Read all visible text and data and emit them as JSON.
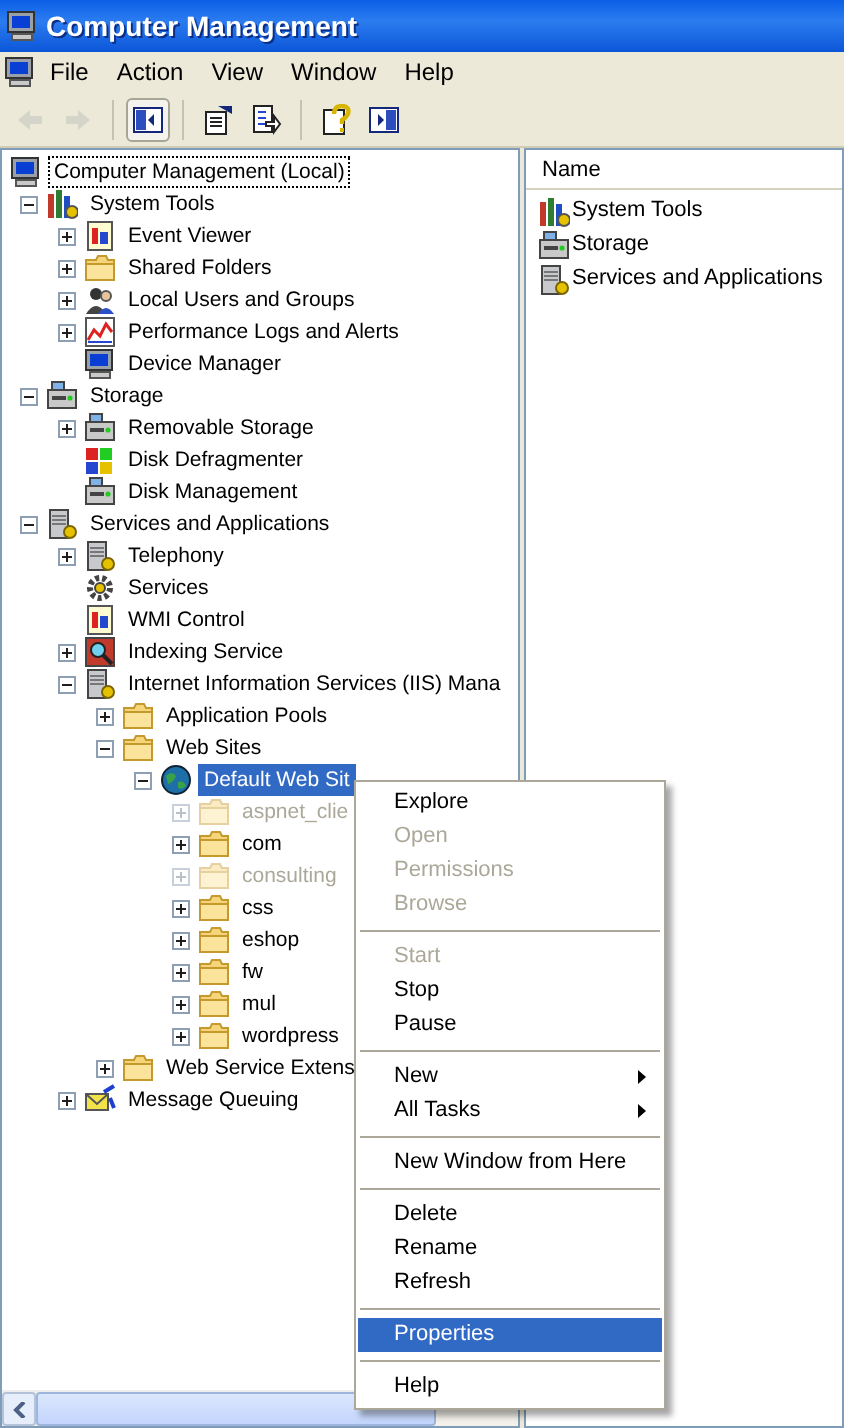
{
  "window": {
    "title": "Computer Management"
  },
  "menu_bar": [
    "File",
    "Action",
    "View",
    "Window",
    "Help"
  ],
  "toolbar": [
    {
      "kind": "back",
      "disabled": true,
      "pressed": false
    },
    {
      "kind": "forward",
      "disabled": true,
      "pressed": false
    },
    {
      "kind": "separator"
    },
    {
      "kind": "tree",
      "disabled": false,
      "pressed": true
    },
    {
      "kind": "separator"
    },
    {
      "kind": "properties",
      "disabled": false,
      "pressed": false
    },
    {
      "kind": "export",
      "disabled": false,
      "pressed": false
    },
    {
      "kind": "separator"
    },
    {
      "kind": "help",
      "disabled": false,
      "pressed": false
    },
    {
      "kind": "pane",
      "disabled": false,
      "pressed": false
    }
  ],
  "tree": [
    {
      "label": "Computer Management (Local)",
      "kind": "computer",
      "selected": false,
      "focused": true,
      "dimmed": false,
      "children": [
        {
          "label": "System Tools",
          "kind": "tools",
          "expanded": true,
          "selected": false,
          "focused": false,
          "dimmed": false,
          "children": [
            {
              "label": "Event Viewer",
              "kind": "log",
              "expanded": false,
              "selected": false,
              "focused": false,
              "dimmed": false
            },
            {
              "label": "Shared Folders",
              "kind": "folder",
              "expanded": false,
              "selected": false,
              "focused": false,
              "dimmed": false
            },
            {
              "label": "Local Users and Groups",
              "kind": "users",
              "expanded": false,
              "selected": false,
              "focused": false,
              "dimmed": false
            },
            {
              "label": "Performance Logs and Alerts",
              "kind": "chart",
              "expanded": false,
              "selected": false,
              "focused": false,
              "dimmed": false
            },
            {
              "label": "Device Manager",
              "kind": "computer",
              "selected": false,
              "focused": false,
              "dimmed": false
            }
          ]
        },
        {
          "label": "Storage",
          "kind": "drive",
          "expanded": true,
          "selected": false,
          "focused": false,
          "dimmed": false,
          "children": [
            {
              "label": "Removable Storage",
              "kind": "drive",
              "expanded": false,
              "selected": false,
              "focused": false,
              "dimmed": false
            },
            {
              "label": "Disk Defragmenter",
              "kind": "blocks",
              "selected": false,
              "focused": false,
              "dimmed": false
            },
            {
              "label": "Disk Management",
              "kind": "drive",
              "selected": false,
              "focused": false,
              "dimmed": false
            }
          ]
        },
        {
          "label": "Services and Applications",
          "kind": "server",
          "expanded": true,
          "selected": false,
          "focused": false,
          "dimmed": false,
          "children": [
            {
              "label": "Telephony",
              "kind": "server",
              "expanded": false,
              "selected": false,
              "focused": false,
              "dimmed": false
            },
            {
              "label": "Services",
              "kind": "gear",
              "selected": false,
              "focused": false,
              "dimmed": false
            },
            {
              "label": "WMI Control",
              "kind": "log",
              "selected": false,
              "focused": false,
              "dimmed": false
            },
            {
              "label": "Indexing Service",
              "kind": "magnifier",
              "expanded": false,
              "selected": false,
              "focused": false,
              "dimmed": false
            },
            {
              "label": "Internet Information Services (IIS) Mana",
              "kind": "server",
              "expanded": true,
              "selected": false,
              "focused": false,
              "dimmed": false,
              "children": [
                {
                  "label": "Application Pools",
                  "kind": "folder",
                  "expanded": false,
                  "selected": false,
                  "focused": false,
                  "dimmed": false
                },
                {
                  "label": "Web Sites",
                  "kind": "folder",
                  "expanded": true,
                  "selected": false,
                  "focused": false,
                  "dimmed": false,
                  "children": [
                    {
                      "label": "Default Web Sit",
                      "kind": "globe",
                      "expanded": true,
                      "selected": true,
                      "focused": false,
                      "dimmed": false,
                      "children": [
                        {
                          "label": "aspnet_clie",
                          "kind": "folder",
                          "expanded": false,
                          "selected": false,
                          "focused": false,
                          "dimmed": true
                        },
                        {
                          "label": "com",
                          "kind": "folder",
                          "expanded": false,
                          "selected": false,
                          "focused": false,
                          "dimmed": false
                        },
                        {
                          "label": "consulting",
                          "kind": "folder",
                          "expanded": false,
                          "selected": false,
                          "focused": false,
                          "dimmed": true
                        },
                        {
                          "label": "css",
                          "kind": "folder",
                          "expanded": false,
                          "selected": false,
                          "focused": false,
                          "dimmed": false
                        },
                        {
                          "label": "eshop",
                          "kind": "folder",
                          "expanded": false,
                          "selected": false,
                          "focused": false,
                          "dimmed": false
                        },
                        {
                          "label": "fw",
                          "kind": "folder",
                          "expanded": false,
                          "selected": false,
                          "focused": false,
                          "dimmed": false
                        },
                        {
                          "label": "mul",
                          "kind": "folder",
                          "expanded": false,
                          "selected": false,
                          "focused": false,
                          "dimmed": false
                        },
                        {
                          "label": "wordpress",
                          "kind": "folder",
                          "expanded": false,
                          "selected": false,
                          "focused": false,
                          "dimmed": false
                        }
                      ]
                    }
                  ]
                },
                {
                  "label": "Web Service Extens",
                  "kind": "folder",
                  "expanded": false,
                  "selected": false,
                  "focused": false,
                  "dimmed": false
                }
              ]
            },
            {
              "label": "Message Queuing",
              "kind": "envelope",
              "expanded": false,
              "selected": false,
              "focused": false,
              "dimmed": false
            }
          ]
        }
      ]
    }
  ],
  "list_pane": {
    "column_header": "Name",
    "items": [
      {
        "label": "System Tools",
        "kind": "tools"
      },
      {
        "label": "Storage",
        "kind": "drive"
      },
      {
        "label": "Services and Applications",
        "kind": "server"
      }
    ]
  },
  "context_menu": [
    {
      "kind": "item",
      "label": "Explore",
      "disabled": false,
      "selected": false,
      "submenu": false
    },
    {
      "kind": "item",
      "label": "Open",
      "disabled": true,
      "selected": false,
      "submenu": false
    },
    {
      "kind": "item",
      "label": "Permissions",
      "disabled": true,
      "selected": false,
      "submenu": false
    },
    {
      "kind": "item",
      "label": "Browse",
      "disabled": true,
      "selected": false,
      "submenu": false
    },
    {
      "kind": "separator"
    },
    {
      "kind": "item",
      "label": "Start",
      "disabled": true,
      "selected": false,
      "submenu": false
    },
    {
      "kind": "item",
      "label": "Stop",
      "disabled": false,
      "selected": false,
      "submenu": false
    },
    {
      "kind": "item",
      "label": "Pause",
      "disabled": false,
      "selected": false,
      "submenu": false
    },
    {
      "kind": "separator"
    },
    {
      "kind": "item",
      "label": "New",
      "disabled": false,
      "selected": false,
      "submenu": true
    },
    {
      "kind": "item",
      "label": "All Tasks",
      "disabled": false,
      "selected": false,
      "submenu": true
    },
    {
      "kind": "separator"
    },
    {
      "kind": "item",
      "label": "New Window from Here",
      "disabled": false,
      "selected": false,
      "submenu": false
    },
    {
      "kind": "separator"
    },
    {
      "kind": "item",
      "label": "Delete",
      "disabled": false,
      "selected": false,
      "submenu": false
    },
    {
      "kind": "item",
      "label": "Rename",
      "disabled": false,
      "selected": false,
      "submenu": false
    },
    {
      "kind": "item",
      "label": "Refresh",
      "disabled": false,
      "selected": false,
      "submenu": false
    },
    {
      "kind": "separator"
    },
    {
      "kind": "item",
      "label": "Properties",
      "disabled": false,
      "selected": true,
      "submenu": false
    },
    {
      "kind": "separator"
    },
    {
      "kind": "item",
      "label": "Help",
      "disabled": false,
      "selected": false,
      "submenu": false
    }
  ]
}
